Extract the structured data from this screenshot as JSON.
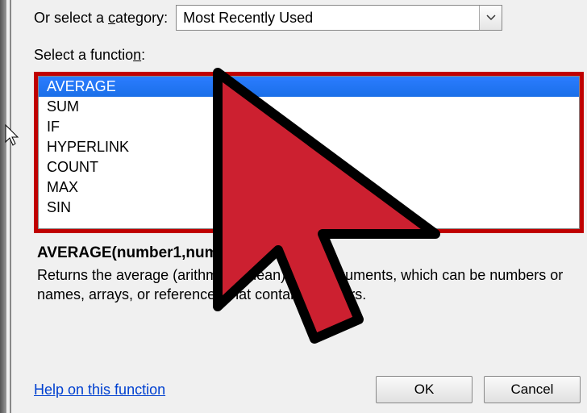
{
  "category": {
    "label_prefix": "Or select a ",
    "label_underline": "c",
    "label_suffix": "ategory:",
    "value": "Most Recently Used"
  },
  "select_function": {
    "label_prefix": "Select a functio",
    "label_underline": "n",
    "label_suffix": ":"
  },
  "functions": {
    "items": [
      {
        "label": "AVERAGE"
      },
      {
        "label": "SUM"
      },
      {
        "label": "IF"
      },
      {
        "label": "HYPERLINK"
      },
      {
        "label": "COUNT"
      },
      {
        "label": "MAX"
      },
      {
        "label": "SIN"
      }
    ]
  },
  "signature": "AVERAGE(number1,numb",
  "description": "Returns the average (arithmetic mean) of its arguments, which can be numbers or names, arrays, or references that contain numbers.",
  "help_link": "Help on this function",
  "buttons": {
    "ok": "OK",
    "cancel": "Cancel"
  },
  "colors": {
    "highlight_border": "#c00000",
    "selection_bg": "#1e90ff"
  }
}
